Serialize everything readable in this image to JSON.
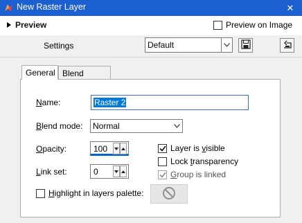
{
  "window": {
    "title": "New Raster Layer",
    "close_glyph": "✕"
  },
  "topbar": {
    "preview_label": "Preview",
    "preview_on_image_label": "Preview on Image",
    "preview_on_image_checked": false
  },
  "settings": {
    "label": "Settings",
    "preset_value": "Default"
  },
  "tabs": [
    {
      "label": "General",
      "active": true
    },
    {
      "label": "Blend Ranges",
      "active": false
    }
  ],
  "general": {
    "name": {
      "label_u": "N",
      "label_rest": "ame:",
      "value": "Raster 2"
    },
    "blend_mode": {
      "label_u": "B",
      "label_rest": "lend mode:",
      "value": "Normal"
    },
    "opacity": {
      "label_u": "O",
      "label_rest": "pacity:",
      "value": "100"
    },
    "link_set": {
      "label_u": "L",
      "label_rest": "ink set:",
      "value": "0"
    },
    "layer_visible": {
      "label_pre": "Layer is ",
      "label_u": "v",
      "label_post": "isible",
      "checked": true
    },
    "lock_transparency": {
      "label_pre": "Lock ",
      "label_u": "t",
      "label_post": "ransparency",
      "checked": false
    },
    "group_linked": {
      "label_pre": "",
      "label_u": "G",
      "label_post": "roup is linked",
      "checked": true,
      "disabled": true
    },
    "highlight": {
      "label_pre": "",
      "label_u": "H",
      "label_post": "ighlight in layers palette:",
      "checked": false
    }
  },
  "colors": {
    "titlebar": "#1c5fd0",
    "selection": "#0078d7"
  },
  "icons": {
    "app": "paint-shop-icon",
    "save": "save-disk-icon",
    "reset": "reset-icon",
    "none_color": "no-color-icon"
  }
}
